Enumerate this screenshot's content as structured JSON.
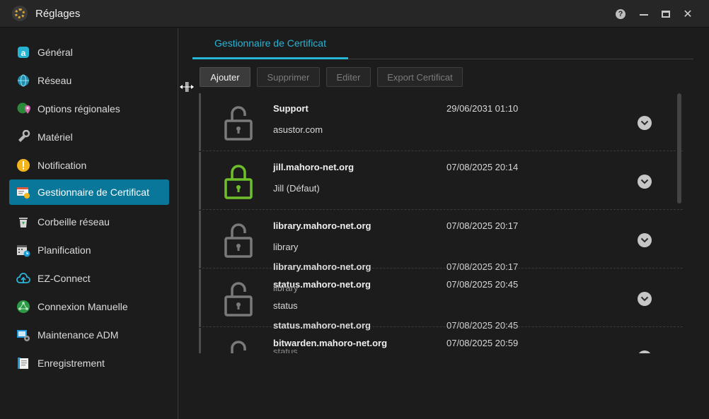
{
  "window": {
    "title": "Réglages"
  },
  "sidebar": {
    "items": [
      {
        "label": "Général",
        "icon": "general-icon"
      },
      {
        "label": "Réseau",
        "icon": "globe-icon"
      },
      {
        "label": "Options régionales",
        "icon": "region-pin-icon"
      },
      {
        "label": "Matériel",
        "icon": "hardware-icon"
      },
      {
        "label": "Notification",
        "icon": "alert-icon"
      },
      {
        "label": "Gestionnaire de Certificat",
        "icon": "certificate-icon",
        "active": true
      },
      {
        "label": "Corbeille réseau",
        "icon": "recycle-bin-icon"
      },
      {
        "label": "Planification",
        "icon": "calendar-clock-icon"
      },
      {
        "label": "EZ-Connect",
        "icon": "cloud-upload-icon"
      },
      {
        "label": "Connexion Manuelle",
        "icon": "network-icon"
      },
      {
        "label": "Maintenance ADM",
        "icon": "maintenance-icon"
      },
      {
        "label": "Enregistrement",
        "icon": "log-icon"
      }
    ]
  },
  "main": {
    "tab": "Gestionnaire de Certificat",
    "buttons": {
      "add": "Ajouter",
      "delete": "Supprimer",
      "edit": "Editer",
      "export": "Export Certificat"
    },
    "certificates": [
      {
        "name": "Support",
        "sub": "asustor.com",
        "date": "29/06/2031 01:10",
        "default": false
      },
      {
        "name": "jill.mahoro-net.org",
        "sub": "Jill (Défaut)",
        "date": "07/08/2025 20:14",
        "default": true
      },
      {
        "name": "library.mahoro-net.org",
        "sub": "library",
        "date": "07/08/2025 20:17",
        "default": false
      },
      {
        "name": "status.mahoro-net.org",
        "sub": "status",
        "date": "07/08/2025 20:45",
        "default": false
      },
      {
        "name": "bitwarden.mahoro-net.org",
        "sub": "status",
        "date": "07/08/2025 20:59",
        "default": false
      }
    ],
    "ghost": {
      "r3_name": "library.mahoro-net.org",
      "r3_date": "07/08/2025 20:17",
      "r3_sub": "library",
      "r4_name": "status.mahoro-net.org",
      "r4_date": "07/08/2025 20:45"
    }
  },
  "colors": {
    "accent": "#27b5d7",
    "active_nav": "#08779a",
    "lock_default": "#6fbf2d",
    "lock_normal": "#7a7a7a"
  }
}
